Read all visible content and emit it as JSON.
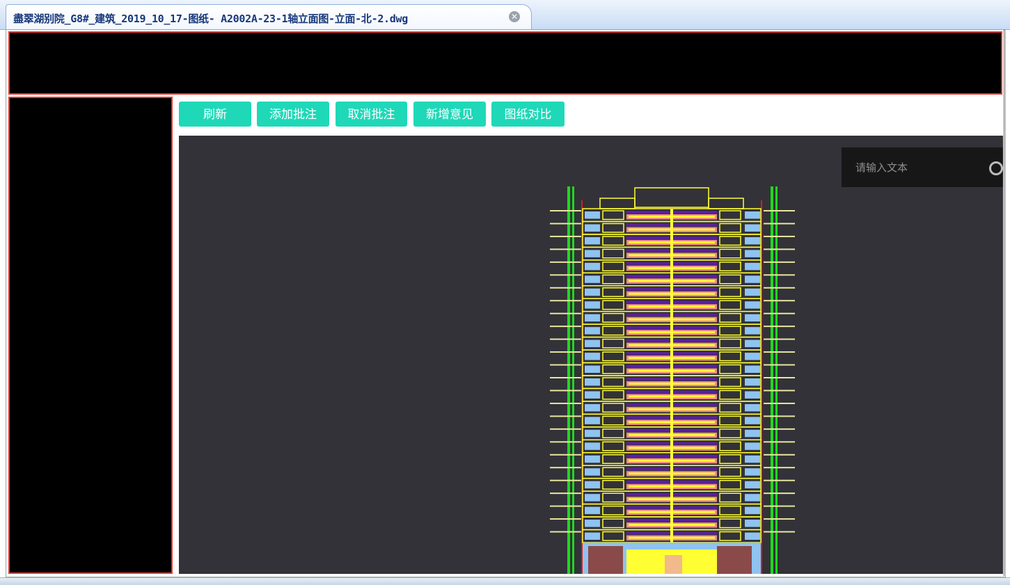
{
  "tab": {
    "title": "盡翠湖别院_G8#_建筑_2019_10_17-图纸- A2002A-23-1轴立面图-立面-北-2.dwg",
    "close_icon": "close-circle-icon"
  },
  "toolbar": {
    "buttons": [
      {
        "label": "刷新"
      },
      {
        "label": "添加批注"
      },
      {
        "label": "取消批注"
      },
      {
        "label": "新增意见"
      },
      {
        "label": "图纸对比"
      }
    ],
    "button_color": "#1fd8b8"
  },
  "viewer": {
    "background": "#333238",
    "search": {
      "placeholder": "请输入文本",
      "icon": "search-icon"
    },
    "drawing": {
      "floors": 26
    }
  }
}
